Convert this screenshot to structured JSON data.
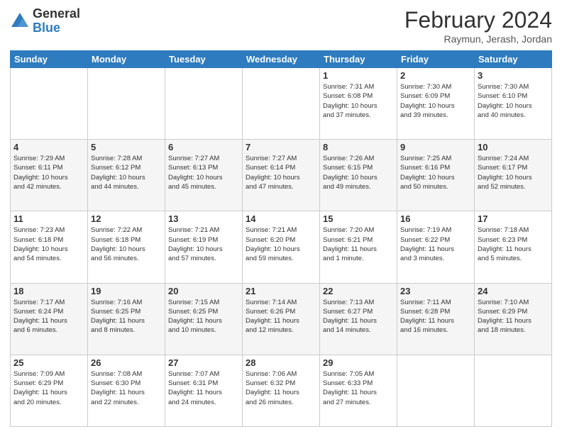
{
  "header": {
    "logo_general": "General",
    "logo_blue": "Blue",
    "title": "February 2024",
    "location": "Raymun, Jerash, Jordan"
  },
  "weekdays": [
    "Sunday",
    "Monday",
    "Tuesday",
    "Wednesday",
    "Thursday",
    "Friday",
    "Saturday"
  ],
  "weeks": [
    [
      {
        "day": "",
        "info": ""
      },
      {
        "day": "",
        "info": ""
      },
      {
        "day": "",
        "info": ""
      },
      {
        "day": "",
        "info": ""
      },
      {
        "day": "1",
        "info": "Sunrise: 7:31 AM\nSunset: 6:08 PM\nDaylight: 10 hours\nand 37 minutes."
      },
      {
        "day": "2",
        "info": "Sunrise: 7:30 AM\nSunset: 6:09 PM\nDaylight: 10 hours\nand 39 minutes."
      },
      {
        "day": "3",
        "info": "Sunrise: 7:30 AM\nSunset: 6:10 PM\nDaylight: 10 hours\nand 40 minutes."
      }
    ],
    [
      {
        "day": "4",
        "info": "Sunrise: 7:29 AM\nSunset: 6:11 PM\nDaylight: 10 hours\nand 42 minutes."
      },
      {
        "day": "5",
        "info": "Sunrise: 7:28 AM\nSunset: 6:12 PM\nDaylight: 10 hours\nand 44 minutes."
      },
      {
        "day": "6",
        "info": "Sunrise: 7:27 AM\nSunset: 6:13 PM\nDaylight: 10 hours\nand 45 minutes."
      },
      {
        "day": "7",
        "info": "Sunrise: 7:27 AM\nSunset: 6:14 PM\nDaylight: 10 hours\nand 47 minutes."
      },
      {
        "day": "8",
        "info": "Sunrise: 7:26 AM\nSunset: 6:15 PM\nDaylight: 10 hours\nand 49 minutes."
      },
      {
        "day": "9",
        "info": "Sunrise: 7:25 AM\nSunset: 6:16 PM\nDaylight: 10 hours\nand 50 minutes."
      },
      {
        "day": "10",
        "info": "Sunrise: 7:24 AM\nSunset: 6:17 PM\nDaylight: 10 hours\nand 52 minutes."
      }
    ],
    [
      {
        "day": "11",
        "info": "Sunrise: 7:23 AM\nSunset: 6:18 PM\nDaylight: 10 hours\nand 54 minutes."
      },
      {
        "day": "12",
        "info": "Sunrise: 7:22 AM\nSunset: 6:18 PM\nDaylight: 10 hours\nand 56 minutes."
      },
      {
        "day": "13",
        "info": "Sunrise: 7:21 AM\nSunset: 6:19 PM\nDaylight: 10 hours\nand 57 minutes."
      },
      {
        "day": "14",
        "info": "Sunrise: 7:21 AM\nSunset: 6:20 PM\nDaylight: 10 hours\nand 59 minutes."
      },
      {
        "day": "15",
        "info": "Sunrise: 7:20 AM\nSunset: 6:21 PM\nDaylight: 11 hours\nand 1 minute."
      },
      {
        "day": "16",
        "info": "Sunrise: 7:19 AM\nSunset: 6:22 PM\nDaylight: 11 hours\nand 3 minutes."
      },
      {
        "day": "17",
        "info": "Sunrise: 7:18 AM\nSunset: 6:23 PM\nDaylight: 11 hours\nand 5 minutes."
      }
    ],
    [
      {
        "day": "18",
        "info": "Sunrise: 7:17 AM\nSunset: 6:24 PM\nDaylight: 11 hours\nand 6 minutes."
      },
      {
        "day": "19",
        "info": "Sunrise: 7:16 AM\nSunset: 6:25 PM\nDaylight: 11 hours\nand 8 minutes."
      },
      {
        "day": "20",
        "info": "Sunrise: 7:15 AM\nSunset: 6:25 PM\nDaylight: 11 hours\nand 10 minutes."
      },
      {
        "day": "21",
        "info": "Sunrise: 7:14 AM\nSunset: 6:26 PM\nDaylight: 11 hours\nand 12 minutes."
      },
      {
        "day": "22",
        "info": "Sunrise: 7:13 AM\nSunset: 6:27 PM\nDaylight: 11 hours\nand 14 minutes."
      },
      {
        "day": "23",
        "info": "Sunrise: 7:11 AM\nSunset: 6:28 PM\nDaylight: 11 hours\nand 16 minutes."
      },
      {
        "day": "24",
        "info": "Sunrise: 7:10 AM\nSunset: 6:29 PM\nDaylight: 11 hours\nand 18 minutes."
      }
    ],
    [
      {
        "day": "25",
        "info": "Sunrise: 7:09 AM\nSunset: 6:29 PM\nDaylight: 11 hours\nand 20 minutes."
      },
      {
        "day": "26",
        "info": "Sunrise: 7:08 AM\nSunset: 6:30 PM\nDaylight: 11 hours\nand 22 minutes."
      },
      {
        "day": "27",
        "info": "Sunrise: 7:07 AM\nSunset: 6:31 PM\nDaylight: 11 hours\nand 24 minutes."
      },
      {
        "day": "28",
        "info": "Sunrise: 7:06 AM\nSunset: 6:32 PM\nDaylight: 11 hours\nand 26 minutes."
      },
      {
        "day": "29",
        "info": "Sunrise: 7:05 AM\nSunset: 6:33 PM\nDaylight: 11 hours\nand 27 minutes."
      },
      {
        "day": "",
        "info": ""
      },
      {
        "day": "",
        "info": ""
      }
    ]
  ]
}
